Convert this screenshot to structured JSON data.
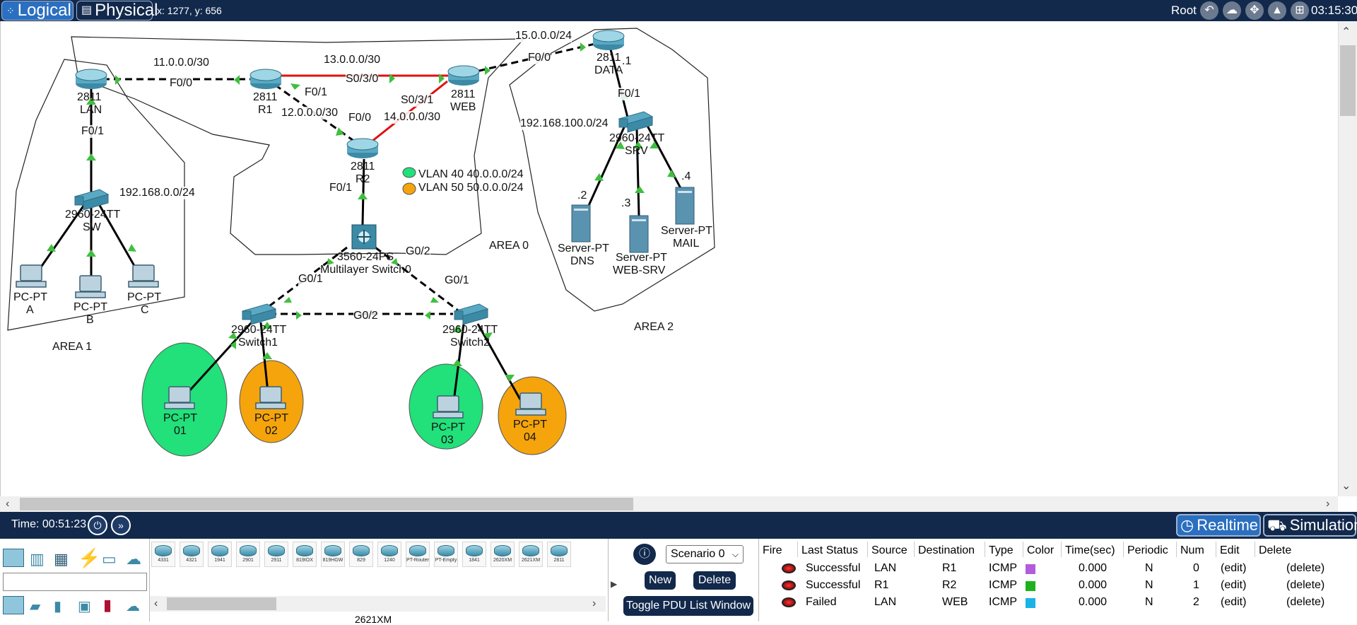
{
  "topbar": {
    "logical_label": "Logical",
    "physical_label": "Physical",
    "coords": "x: 1277, y: 656",
    "root_label": "Root",
    "clock": "03:15:30",
    "icons": [
      "back-icon",
      "cloud-icon",
      "move-icon",
      "background-image-icon",
      "viewport-icon"
    ]
  },
  "topology": {
    "devices": [
      {
        "model": "2811",
        "name": "LAN"
      },
      {
        "model": "2811",
        "name": "R1"
      },
      {
        "model": "2811",
        "name": "WEB"
      },
      {
        "model": "2811",
        "name": "DATA"
      },
      {
        "model": "2811",
        "name": "R2"
      },
      {
        "model": "2960-24TT",
        "name": "SW"
      },
      {
        "model": "2960-24TT",
        "name": "SRV"
      },
      {
        "model": "3560-24PS",
        "name": "Multilayer Switch0"
      },
      {
        "model": "2960-24TT",
        "name": "Switch1"
      },
      {
        "model": "2960-24TT",
        "name": "Switch2"
      },
      {
        "model": "PC-PT",
        "name": "A"
      },
      {
        "model": "PC-PT",
        "name": "B"
      },
      {
        "model": "PC-PT",
        "name": "C"
      },
      {
        "model": "PC-PT",
        "name": "01"
      },
      {
        "model": "PC-PT",
        "name": "02"
      },
      {
        "model": "PC-PT",
        "name": "03"
      },
      {
        "model": "PC-PT",
        "name": "04"
      },
      {
        "model": "Server-PT",
        "name": "DNS"
      },
      {
        "model": "Server-PT",
        "name": "WEB-SRV"
      },
      {
        "model": "Server-PT",
        "name": "MAIL"
      }
    ],
    "labels": {
      "net_11": "11.0.0.0/30",
      "net_13": "13.0.0.0/30",
      "net_15": "15.0.0.0/24",
      "net_12": "12.0.0.0/30",
      "net_14": "14.0.0.0/30",
      "net_192_0": "192.168.0.0/24",
      "net_192_100": "192.168.100.0/24",
      "f00_a": "F0/0",
      "f01_a": "F0/1",
      "s030": "S0/3/0",
      "s031": "S0/3/1",
      "f00_b": "F0/0",
      "f01_b": "F0/1",
      "f00_c": "F0/0",
      "f01_c": "F0/1",
      "f01_d": "F0/1",
      "dot1": ".1",
      "dot2": ".2",
      "dot3": ".3",
      "dot4": ".4",
      "g01_a": "G0/1",
      "g02_a": "G0/2",
      "g01_b": "G0/1",
      "g02_b": "G0/2",
      "area0": "AREA 0",
      "area1": "AREA 1",
      "area2": "AREA 2",
      "vlan40": "VLAN 40 40.0.0.0/24",
      "vlan50": "VLAN 50 50.0.0.0/24"
    },
    "colors": {
      "vlan40": "#22e07a",
      "vlan50": "#f5a40c",
      "serial_link": "#e01010",
      "link_up": "#3fbf3f"
    }
  },
  "timebar": {
    "time": "Time: 00:51:23",
    "realtime_label": "Realtime",
    "simulation_label": "Simulation"
  },
  "device_types": [
    "4331",
    "4321",
    "1941",
    "2901",
    "2911",
    "819IOX",
    "819HGW",
    "829",
    "1240",
    "PT-Router",
    "PT-Empty",
    "1841",
    "2620XM",
    "2621XM",
    "2811"
  ],
  "device_caption": "2621XM",
  "pdu": {
    "scenario": "Scenario 0",
    "new_label": "New",
    "delete_label": "Delete",
    "toggle_label": "Toggle PDU List Window",
    "info_icon": "info-icon"
  },
  "pdu_table": {
    "headers": [
      "Fire",
      "Last Status",
      "Source",
      "Destination",
      "Type",
      "Color",
      "Time(sec)",
      "Periodic",
      "Num",
      "Edit",
      "Delete"
    ],
    "rows": [
      {
        "status": "Successful",
        "source": "LAN",
        "destination": "R1",
        "type": "ICMP",
        "color": "#b15ddb",
        "time": "0.000",
        "periodic": "N",
        "num": "0",
        "edit": "(edit)",
        "delete": "(delete)"
      },
      {
        "status": "Successful",
        "source": "R1",
        "destination": "R2",
        "type": "ICMP",
        "color": "#1db21d",
        "time": "0.000",
        "periodic": "N",
        "num": "1",
        "edit": "(edit)",
        "delete": "(delete)"
      },
      {
        "status": "Failed",
        "source": "LAN",
        "destination": "WEB",
        "type": "ICMP",
        "color": "#1ab3e8",
        "time": "0.000",
        "periodic": "N",
        "num": "2",
        "edit": "(edit)",
        "delete": "(delete)"
      }
    ]
  }
}
